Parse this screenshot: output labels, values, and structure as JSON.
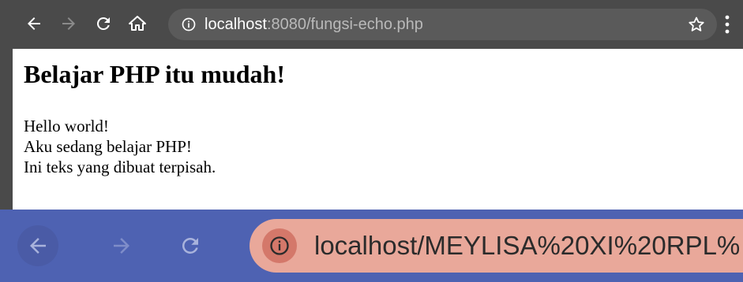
{
  "top_browser": {
    "url_host": "localhost",
    "url_rest": ":8080/fungsi-echo.php",
    "icons": [
      "back-icon",
      "forward-icon",
      "reload-icon",
      "home-icon",
      "info-icon",
      "star-icon",
      "menu-icon"
    ],
    "colors": {
      "toolbar": "#4a4a4a",
      "omnibox": "#5a5a5a"
    }
  },
  "page": {
    "heading": "Belajar PHP itu mudah!",
    "lines": [
      "Hello world!",
      "Aku sedang belajar PHP!",
      "Ini teks yang dibuat terpisah."
    ]
  },
  "bottom_browser": {
    "url": "localhost/MEYLISA%20XI%20RPL%",
    "icons": [
      "back-icon",
      "forward-icon",
      "reload-icon",
      "info-icon"
    ],
    "colors": {
      "toolbar": "#4e62b2",
      "omnibox": "#e9a89a"
    }
  }
}
